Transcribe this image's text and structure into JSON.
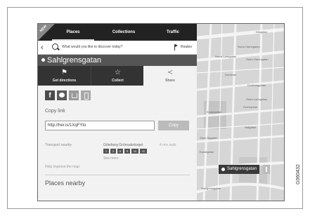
{
  "header": {
    "badge": "NEW",
    "tabs": [
      {
        "label": "Places",
        "active": true
      },
      {
        "label": "Collections",
        "active": false
      },
      {
        "label": "Traffic",
        "active": false
      }
    ]
  },
  "search": {
    "placeholder": "What would you like to discover today?",
    "routes_label": "Routes"
  },
  "place": {
    "title": "Sahlgrensgatan"
  },
  "actions": [
    {
      "label": "Get directions",
      "icon": "directions-icon"
    },
    {
      "label": "Collect",
      "icon": "star-icon"
    },
    {
      "label": "Share",
      "icon": "share-icon"
    }
  ],
  "share": {
    "buttons": [
      "facebook-icon",
      "messenger-icon",
      "download-icon",
      "phone-icon"
    ],
    "facebook_glyph": "f",
    "copy_label": "Copy link",
    "link": "http://her.is/1XqFYto",
    "copy_button": "Copy"
  },
  "transport": {
    "label": "Transport nearby",
    "stop": "Göteborg Grönsakstorget",
    "walk": "4 min walk",
    "lines": [
      "1",
      "2",
      "6",
      "9",
      "10",
      "11"
    ],
    "see_more": "See more"
  },
  "help": "Help improve the map",
  "nearby": "Places nearby",
  "map": {
    "pin_label": "Sahlgrensgatan",
    "streets": [
      "Kilsgatan",
      "Norra Hamngatan",
      "Östra Hamngatan",
      "Drottninggatan",
      "Östra Larmgatan",
      "Domkyrkan",
      "Kungsgatan",
      "Vallgatan",
      "Stora Nygatan",
      "Kanalgatan",
      "Sahlgrensgatan",
      "Nordstan",
      "Norra Larmgatan"
    ]
  },
  "code": "G060432",
  "colors": {
    "bar": "#222222",
    "title": "#555555",
    "panel": "#f2f2f2",
    "map": "#d8d8d8"
  }
}
